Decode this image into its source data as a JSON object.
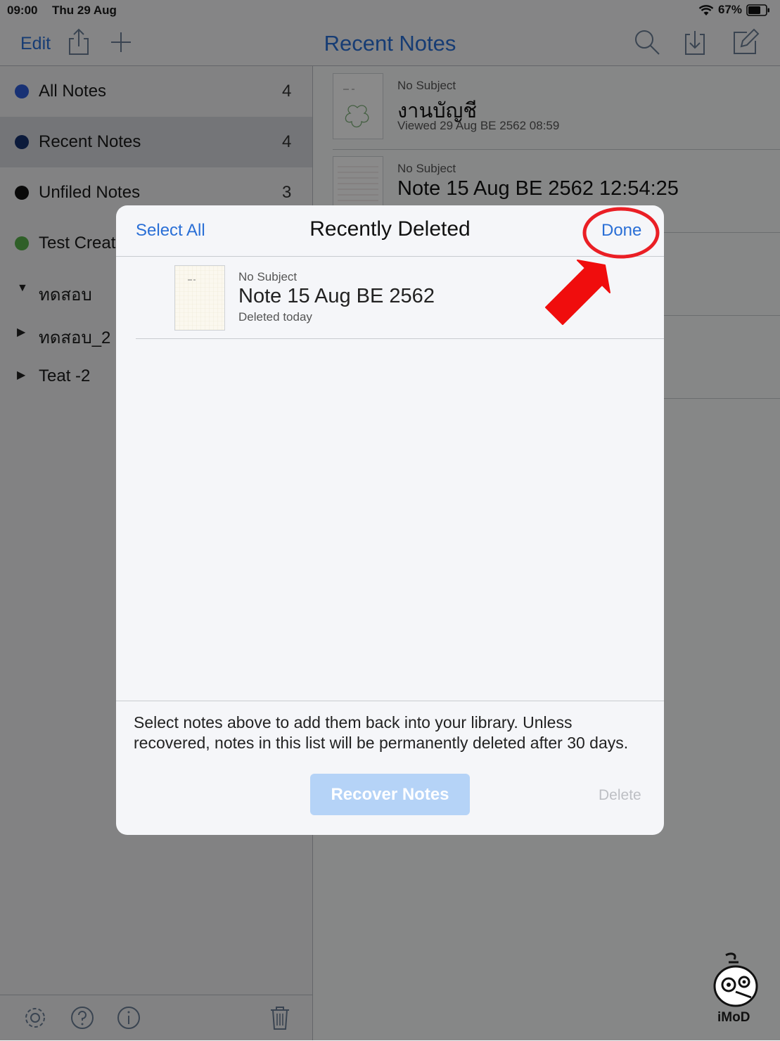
{
  "status_bar": {
    "time": "09:00",
    "date": "Thu 29 Aug",
    "battery": "67%"
  },
  "navbar": {
    "edit": "Edit",
    "title": "Recent Notes"
  },
  "sidebar": {
    "items": [
      {
        "label": "All Notes",
        "count": "4",
        "color": "#2e5bd6"
      },
      {
        "label": "Recent Notes",
        "count": "4",
        "color": "#15306e"
      },
      {
        "label": "Unfiled Notes",
        "count": "3",
        "color": "#111111"
      },
      {
        "label": "Test Create",
        "count": "",
        "color": "#57b04b"
      },
      {
        "label": "ทดสอบ",
        "count": "",
        "expanded": true
      },
      {
        "label": "ทดสอบ_2",
        "count": "",
        "expanded": false
      },
      {
        "label": "Teat -2",
        "count": "",
        "expanded": false
      }
    ]
  },
  "notes": [
    {
      "subject": "No Subject",
      "title": "งานบัญชี",
      "meta": "Viewed 29 Aug BE 2562 08:59"
    },
    {
      "subject": "No Subject",
      "title": "Note 15 Aug BE 2562 12:54:25",
      "meta": ""
    }
  ],
  "modal": {
    "select_all": "Select All",
    "title": "Recently Deleted",
    "done": "Done",
    "items": [
      {
        "subject": "No Subject",
        "title": "Note 15 Aug BE 2562",
        "meta": "Deleted today"
      }
    ],
    "message": "Select notes above to add them back into your library. Unless recovered, notes in this list will be permanently deleted after 30 days.",
    "recover_label": "Recover Notes",
    "delete_label": "Delete"
  },
  "watermark": {
    "text": "iMoD"
  }
}
